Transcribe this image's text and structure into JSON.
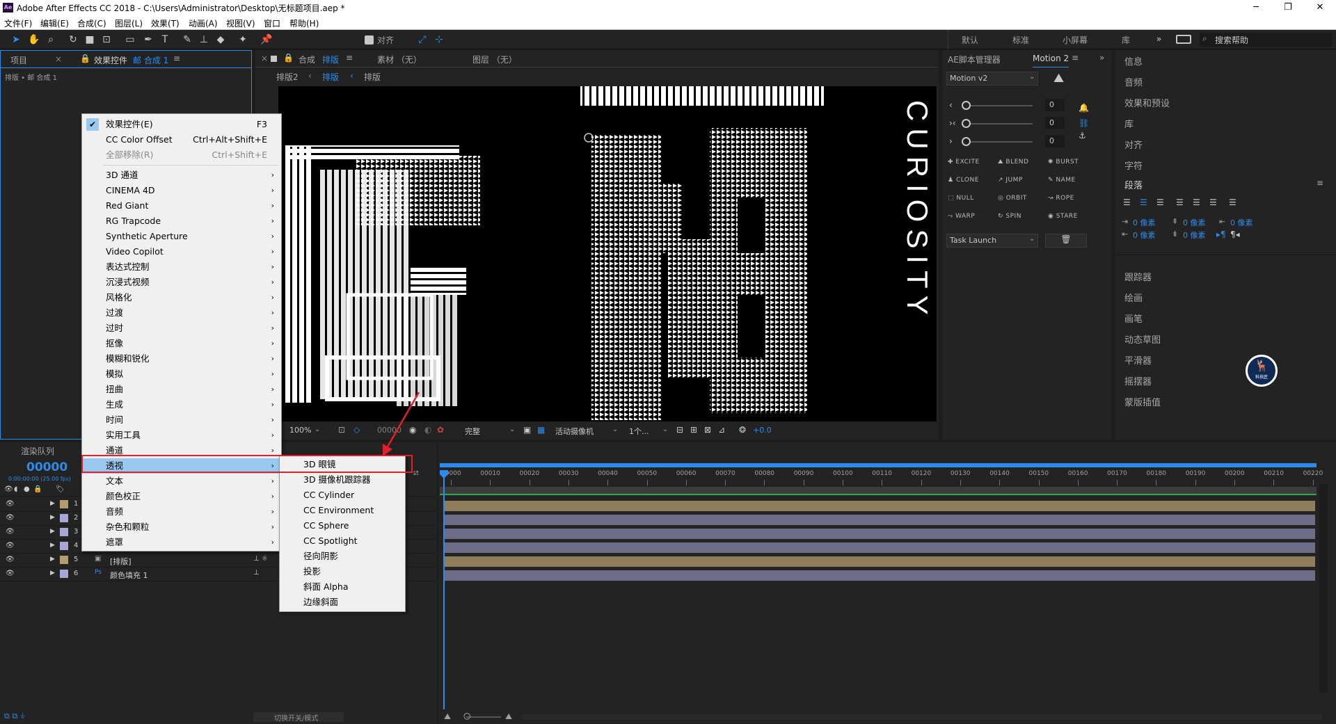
{
  "app": {
    "title": "Adobe After Effects CC 2018 - C:\\Users\\Administrator\\Desktop\\无标题项目.aep *",
    "logo_text": "Ae"
  },
  "menubar": [
    "文件(F)",
    "编辑(E)",
    "合成(C)",
    "图层(L)",
    "效果(T)",
    "动画(A)",
    "视图(V)",
    "窗口",
    "帮助(H)"
  ],
  "toolbar": {
    "align_label": "对齐"
  },
  "workspaces": [
    "默认",
    "标准",
    "小屏幕",
    "库"
  ],
  "search": {
    "placeholder": "搜索帮助"
  },
  "project_panel": {
    "tab_project": "项目",
    "tab_effects": "效果控件",
    "tab_effects_target": "邮 合成 1",
    "breadcrumb": "排版 • 邮 合成 1"
  },
  "comp_panel": {
    "tab_comp": "合成",
    "tab_comp_name": "排版",
    "tab_footage": "素材 （无）",
    "tab_layer": "图层 （无）",
    "nav": [
      "排版2",
      "排版",
      "排版"
    ]
  },
  "viewer_bar": {
    "zoom": "100%",
    "timecode": "00000",
    "quality": "完整",
    "camera": "活动摄像机",
    "views": "1个...",
    "exposure": "+0.0"
  },
  "viewer_art": {
    "vertical_text": "CURIOSITY"
  },
  "aescript": {
    "tab1": "AE脚本管理器",
    "tab2": "Motion 2",
    "preset": "Motion v2",
    "sliders": [
      "0",
      "0",
      "0"
    ],
    "buttons": [
      "EXCITE",
      "BLEND",
      "BURST",
      "CLONE",
      "JUMP",
      "NAME",
      "NULL",
      "ORBIT",
      "ROPE",
      "WARP",
      "SPIN",
      "STARE"
    ],
    "task": "Task Launch"
  },
  "right_panel": {
    "items_top": [
      "信息",
      "音频",
      "效果和预设",
      "库",
      "对齐",
      "字符"
    ],
    "paragraph": "段落",
    "para_values": [
      "0 像素",
      "0 像素",
      "0 像素",
      "0 像素",
      "0 像素"
    ],
    "items_bottom": [
      "跟踪器",
      "绘画",
      "画笔",
      "动态草图",
      "平滑器",
      "摇摆器",
      "蒙版插值"
    ],
    "badge_text": "科技匠"
  },
  "render": {
    "tab_queue": "渲染队列",
    "timecode": "00000",
    "fps": "0:00:00:00 (25.00 fps)",
    "footer": "切换开关/模式"
  },
  "layers": [
    {
      "num": "1",
      "name": "",
      "color": "#b59b72"
    },
    {
      "num": "2",
      "name": "",
      "color": "#a7a7d6"
    },
    {
      "num": "3",
      "name": "",
      "color": "#a7a7d6"
    },
    {
      "num": "4",
      "name": "",
      "color": "#a7a7d6"
    },
    {
      "num": "5",
      "name": "[排版]",
      "color": "#b59b72"
    },
    {
      "num": "6",
      "name": "颜色填充 1",
      "color": "#a7a7d6"
    }
  ],
  "ruler": [
    "00000",
    "00010",
    "00020",
    "00030",
    "00040",
    "00050",
    "00060",
    "00070",
    "00080",
    "00090",
    "00100",
    "00110",
    "00120",
    "00130",
    "00140",
    "00150",
    "00160",
    "00170",
    "00180",
    "00190",
    "00200",
    "00210",
    "00220"
  ],
  "effect_menu": {
    "top": [
      {
        "label": "效果控件(E)",
        "shortcut": "F3",
        "checked": true
      },
      {
        "label": "CC Color Offset",
        "shortcut": "Ctrl+Alt+Shift+E"
      },
      {
        "label": "全部移除(R)",
        "shortcut": "Ctrl+Shift+E",
        "disabled": true
      }
    ],
    "categories": [
      "3D 通道",
      "CINEMA 4D",
      "Red Giant",
      "RG Trapcode",
      "Synthetic Aperture",
      "Video Copilot",
      "表达式控制",
      "沉浸式视频",
      "风格化",
      "过渡",
      "过时",
      "抠像",
      "模糊和锐化",
      "模拟",
      "扭曲",
      "生成",
      "时间",
      "实用工具",
      "通道",
      "透视",
      "文本",
      "颜色校正",
      "音频",
      "杂色和颗粒",
      "遮罩"
    ],
    "highlighted": "透视"
  },
  "perspective_submenu": [
    "3D 眼镜",
    "3D 摄像机跟踪器",
    "CC Cylinder",
    "CC Environment",
    "CC Sphere",
    "CC Spotlight",
    "径向阴影",
    "投影",
    "斜面 Alpha",
    "边缘斜面"
  ],
  "colors": {
    "accent": "#2d8ceb",
    "highlight": "#99c9ef",
    "annotation": "#e0202a"
  }
}
